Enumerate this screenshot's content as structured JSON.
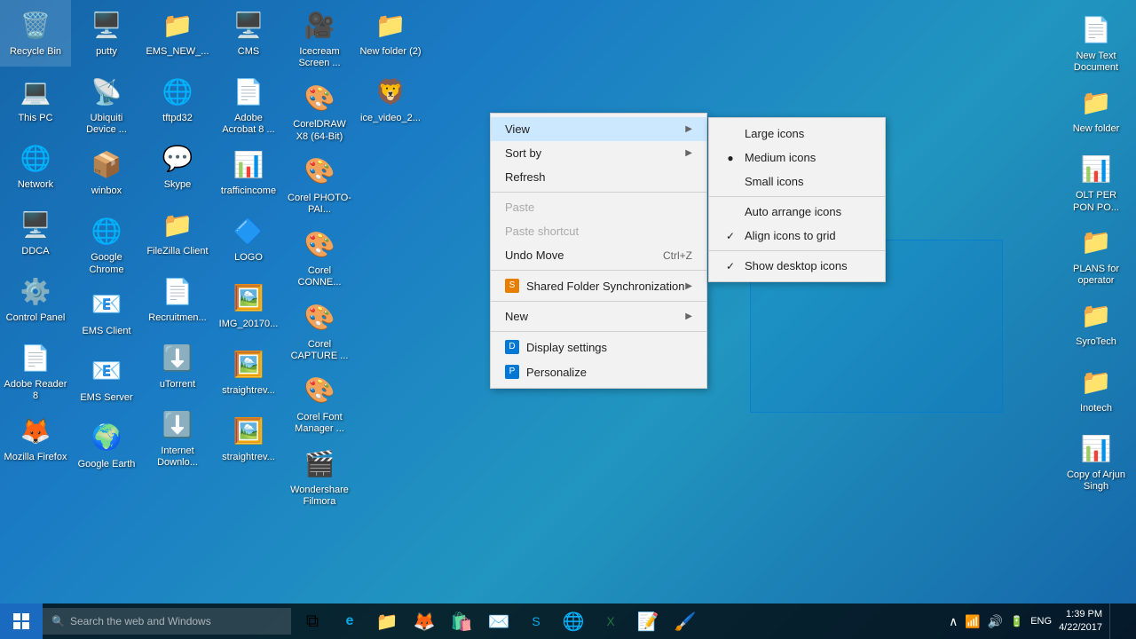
{
  "desktop": {
    "background": "#1a6b9a",
    "icons_left": [
      {
        "id": "recycle-bin",
        "label": "Recycle Bin",
        "icon": "🗑️",
        "row": 1,
        "col": 1
      },
      {
        "id": "putty",
        "label": "putty",
        "icon": "🖥️",
        "row": 1,
        "col": 2
      },
      {
        "id": "ems-new",
        "label": "EMS_NEW_...",
        "icon": "📁",
        "row": 1,
        "col": 3
      },
      {
        "id": "cms",
        "label": "CMS",
        "icon": "🖥️",
        "row": 1,
        "col": 4
      },
      {
        "id": "icecream",
        "label": "Icecream Screen ...",
        "icon": "🎥",
        "row": 1,
        "col": 5
      },
      {
        "id": "new-folder-2",
        "label": "New folder (2)",
        "icon": "📁",
        "row": 1,
        "col": 6
      },
      {
        "id": "this-pc",
        "label": "This PC",
        "icon": "💻",
        "row": 2,
        "col": 1
      },
      {
        "id": "ubiquiti",
        "label": "Ubiquiti Device ...",
        "icon": "📡",
        "row": 2,
        "col": 2
      },
      {
        "id": "tftpd32",
        "label": "tftpd32",
        "icon": "🌐",
        "row": 2,
        "col": 3
      },
      {
        "id": "adobe-acrobat",
        "label": "Adobe Acrobat 8 ...",
        "icon": "📄",
        "row": 2,
        "col": 4
      },
      {
        "id": "coreldraw",
        "label": "CorelDRAW X8 (64-Bit)",
        "icon": "🎨",
        "row": 2,
        "col": 5
      },
      {
        "id": "ice-video",
        "label": "ice_video_2...",
        "icon": "🦁",
        "row": 2,
        "col": 6
      },
      {
        "id": "network",
        "label": "Network",
        "icon": "🌐",
        "row": 3,
        "col": 1
      },
      {
        "id": "winbox",
        "label": "winbox",
        "icon": "📦",
        "row": 3,
        "col": 2
      },
      {
        "id": "skype",
        "label": "Skype",
        "icon": "💬",
        "row": 3,
        "col": 3
      },
      {
        "id": "trafficincome",
        "label": "trafficincome",
        "icon": "📊",
        "row": 3,
        "col": 4
      },
      {
        "id": "corel-photo",
        "label": "Corel PHOTO-PAI...",
        "icon": "🎨",
        "row": 3,
        "col": 5
      },
      {
        "id": "ddca",
        "label": "DDCA",
        "icon": "🖥️",
        "row": 4,
        "col": 1
      },
      {
        "id": "google-chrome",
        "label": "Google Chrome",
        "icon": "🌐",
        "row": 4,
        "col": 2
      },
      {
        "id": "filezilla",
        "label": "FileZilla Client",
        "icon": "📁",
        "row": 4,
        "col": 3
      },
      {
        "id": "logo",
        "label": "LOGO",
        "icon": "🔷",
        "row": 4,
        "col": 4
      },
      {
        "id": "corel-conne",
        "label": "Corel CONNE...",
        "icon": "🎨",
        "row": 4,
        "col": 5
      },
      {
        "id": "control-panel",
        "label": "Control Panel",
        "icon": "⚙️",
        "row": 5,
        "col": 1
      },
      {
        "id": "ems-client",
        "label": "EMS Client",
        "icon": "📧",
        "row": 5,
        "col": 2
      },
      {
        "id": "recruitment",
        "label": "Recruitmen...",
        "icon": "📄",
        "row": 5,
        "col": 3
      },
      {
        "id": "img-2017",
        "label": "IMG_20170...",
        "icon": "🖼️",
        "row": 5,
        "col": 4
      },
      {
        "id": "corel-capture",
        "label": "Corel CAPTURE ...",
        "icon": "🎨",
        "row": 5,
        "col": 5
      },
      {
        "id": "adobe-reader",
        "label": "Adobe Reader 8",
        "icon": "📄",
        "row": 6,
        "col": 1
      },
      {
        "id": "ems-server",
        "label": "EMS Server",
        "icon": "📧",
        "row": 6,
        "col": 2
      },
      {
        "id": "utorrent",
        "label": "uTorrent",
        "icon": "⬇️",
        "row": 6,
        "col": 3
      },
      {
        "id": "straightrev",
        "label": "straightrev...",
        "icon": "🖼️",
        "row": 6,
        "col": 4
      },
      {
        "id": "corel-font",
        "label": "Corel Font Manager ...",
        "icon": "🎨",
        "row": 6,
        "col": 5
      },
      {
        "id": "mozilla",
        "label": "Mozilla Firefox",
        "icon": "🦊",
        "row": 7,
        "col": 1
      },
      {
        "id": "google-earth",
        "label": "Google Earth",
        "icon": "🌍",
        "row": 7,
        "col": 2
      },
      {
        "id": "internet-download",
        "label": "Internet Downlo...",
        "icon": "⬇️",
        "row": 7,
        "col": 3
      },
      {
        "id": "straightrev2",
        "label": "straightrev...",
        "icon": "🖼️",
        "row": 7,
        "col": 4
      },
      {
        "id": "wondershare",
        "label": "Wondershare Filmora",
        "icon": "🎬",
        "row": 7,
        "col": 5
      }
    ],
    "icons_right": [
      {
        "id": "new-text",
        "label": "New Text Document",
        "icon": "📄"
      },
      {
        "id": "new-folder-r",
        "label": "New folder",
        "icon": "📁"
      },
      {
        "id": "olt-per",
        "label": "OLT PER PON PO...",
        "icon": "📊"
      },
      {
        "id": "plans-operator",
        "label": "PLANS for operator",
        "icon": "📁"
      },
      {
        "id": "syrotech",
        "label": "SyroTech",
        "icon": "📁"
      },
      {
        "id": "inotech",
        "label": "Inotech",
        "icon": "📁"
      },
      {
        "id": "copy-arjun",
        "label": "Copy of Arjun Singh",
        "icon": "📊"
      }
    ]
  },
  "context_menu": {
    "items": [
      {
        "id": "view",
        "label": "View",
        "has_submenu": true,
        "disabled": false
      },
      {
        "id": "sort-by",
        "label": "Sort by",
        "has_submenu": true,
        "disabled": false
      },
      {
        "id": "refresh",
        "label": "Refresh",
        "has_submenu": false,
        "disabled": false
      },
      {
        "id": "separator1",
        "type": "separator"
      },
      {
        "id": "paste",
        "label": "Paste",
        "disabled": true
      },
      {
        "id": "paste-shortcut",
        "label": "Paste shortcut",
        "disabled": true
      },
      {
        "id": "undo-move",
        "label": "Undo Move",
        "shortcut": "Ctrl+Z",
        "disabled": false
      },
      {
        "id": "separator2",
        "type": "separator"
      },
      {
        "id": "shared-folder",
        "label": "Shared Folder Synchronization",
        "has_submenu": true,
        "has_icon": true,
        "disabled": false
      },
      {
        "id": "separator3",
        "type": "separator"
      },
      {
        "id": "new",
        "label": "New",
        "has_submenu": true,
        "disabled": false
      },
      {
        "id": "separator4",
        "type": "separator"
      },
      {
        "id": "display-settings",
        "label": "Display settings",
        "has_icon": true,
        "disabled": false
      },
      {
        "id": "personalize",
        "label": "Personalize",
        "has_icon": true,
        "disabled": false
      }
    ]
  },
  "view_submenu": {
    "items": [
      {
        "id": "large-icons",
        "label": "Large icons",
        "checked": false
      },
      {
        "id": "medium-icons",
        "label": "Medium icons",
        "checked": true
      },
      {
        "id": "small-icons",
        "label": "Small icons",
        "checked": false
      },
      {
        "id": "separator"
      },
      {
        "id": "auto-arrange",
        "label": "Auto arrange icons",
        "checked": false
      },
      {
        "id": "align-grid",
        "label": "Align icons to grid",
        "checked": true
      },
      {
        "id": "separator2"
      },
      {
        "id": "show-desktop",
        "label": "Show desktop icons",
        "checked": true
      }
    ]
  },
  "taskbar": {
    "search_placeholder": "Search the web and Windows",
    "clock": "1:39 PM",
    "date": "4/22/2017",
    "apps": [
      {
        "id": "task-view",
        "icon": "⧉"
      },
      {
        "id": "edge",
        "icon": "e"
      },
      {
        "id": "explorer",
        "icon": "📁"
      },
      {
        "id": "firefox",
        "icon": "🦊"
      },
      {
        "id": "store",
        "icon": "🛍️"
      },
      {
        "id": "mail",
        "icon": "✉️"
      },
      {
        "id": "skype-tb",
        "icon": "S"
      },
      {
        "id": "chrome-tb",
        "icon": "⊙"
      },
      {
        "id": "excel-tb",
        "icon": "X"
      },
      {
        "id": "sticky",
        "icon": "📝"
      },
      {
        "id": "paint",
        "icon": "🖌️"
      }
    ]
  }
}
